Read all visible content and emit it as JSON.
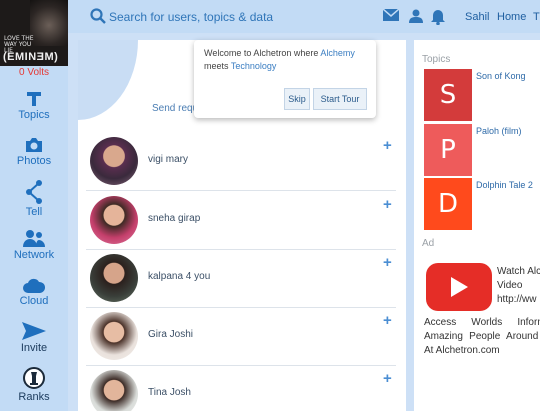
{
  "sidebar": {
    "album_line1": "LOVE THE WAY YOU LIE",
    "album_line2": "(EMINƎM)",
    "volts": "0 Volts",
    "items": [
      {
        "label": "Topics",
        "icon": "topics-icon"
      },
      {
        "label": "Photos",
        "icon": "camera-icon"
      },
      {
        "label": "Tell",
        "icon": "share-icon"
      },
      {
        "label": "Network",
        "icon": "network-icon"
      },
      {
        "label": "Cloud",
        "icon": "cloud-icon"
      },
      {
        "label": "Invite",
        "icon": "send-icon"
      },
      {
        "label": "Ranks",
        "icon": "ranks-icon"
      }
    ]
  },
  "header": {
    "search_placeholder": "Search for users, topics & data",
    "user": "Sahil",
    "home": "Home",
    "overflow": "T"
  },
  "main": {
    "send_requests": "Send requ",
    "people": [
      {
        "name": "vigi mary"
      },
      {
        "name": "sneha girap"
      },
      {
        "name": "kalpana 4 you"
      },
      {
        "name": "Gira Joshi"
      },
      {
        "name": "Tina Josh"
      }
    ],
    "add_symbol": "+"
  },
  "popup": {
    "welcome_pre": "Welcome to Alchetron where",
    "alchemy": "Alchemy",
    "meets": "meets",
    "technology": "Technology",
    "skip": "Skip",
    "start_tour": "Start Tour"
  },
  "right": {
    "topics_title": "Topics",
    "topics": [
      {
        "letter": "S",
        "title": "Son of Kong",
        "color": "#d33b3b"
      },
      {
        "letter": "P",
        "title": "Paloh (film)",
        "color": "#ee5b5b"
      },
      {
        "letter": "D",
        "title": "Dolphin Tale 2",
        "color": "#ff4a1c"
      }
    ],
    "ad_title": "Ad",
    "ad_line1": "Watch Alc",
    "ad_line2": "Video",
    "ad_line3": "http://ww",
    "ad_desc": "Access Worlds Informat Amazing People Around W At Alchetron.com"
  }
}
